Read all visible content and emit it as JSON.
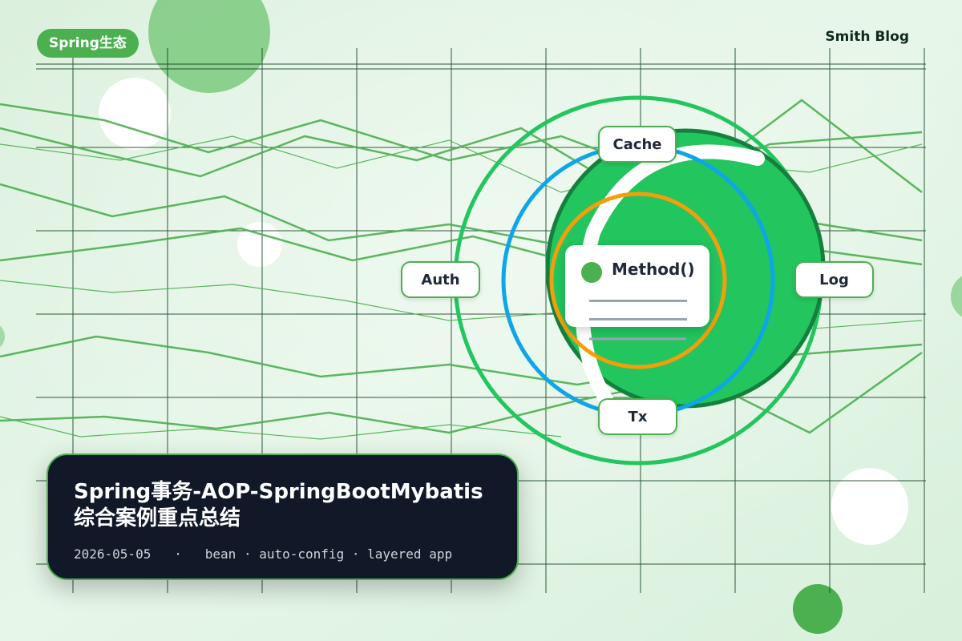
{
  "tag": {
    "label": "Spring生态"
  },
  "brand": {
    "name": "Smith Blog"
  },
  "diagram": {
    "nodes": {
      "top": "Cache",
      "left": "Auth",
      "right": "Log",
      "bottom": "Tx"
    },
    "center_label": "Method()",
    "colors": {
      "outer_ring": "#22c55e",
      "middle_ring": "#0ea5e9",
      "inner_ring": "#f59e0b",
      "core": "#22c55e"
    }
  },
  "card": {
    "title": "Spring事务-AOP-SpringBootMybatis综合案例重点总结",
    "date": "2026-05-05",
    "separator": "·",
    "tags": [
      "bean",
      "auto-config",
      "layered app"
    ]
  }
}
